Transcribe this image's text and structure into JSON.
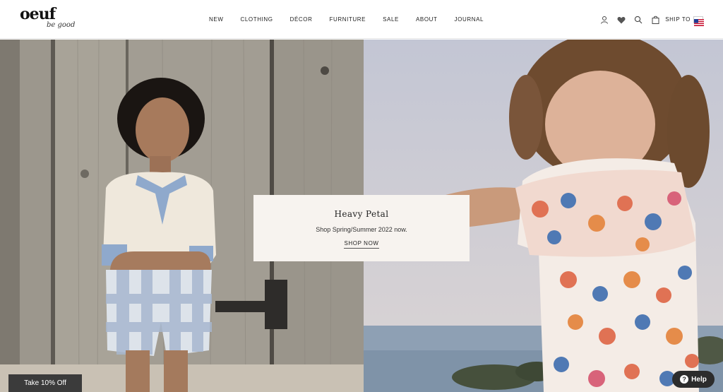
{
  "header": {
    "logo_text": "oeuf",
    "logo_tagline": "be good",
    "nav": [
      "NEW",
      "CLOTHING",
      "DÉCOR",
      "FURNITURE",
      "SALE",
      "ABOUT",
      "JOURNAL"
    ],
    "ship_label": "SHIP TO"
  },
  "promo": {
    "title": "Heavy Petal",
    "subtitle": "Shop Spring/Summer 2022 now.",
    "cta": "SHOP NOW"
  },
  "discount_label": "Take 10% Off",
  "help_label": "Help",
  "colors": {
    "promo_bg": "#f7f3ef",
    "tab_bg": "#3b3b3b",
    "help_bg": "#2c2c2c"
  }
}
